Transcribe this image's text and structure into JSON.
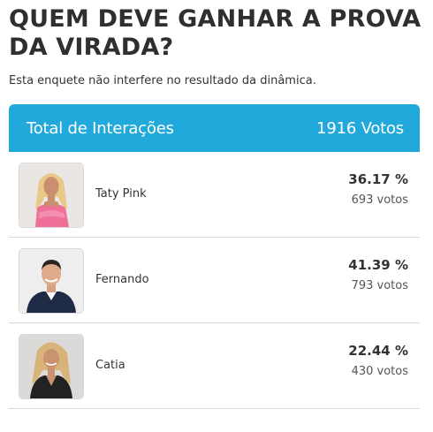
{
  "poll": {
    "title": "QUEM DEVE GANHAR A PROVA DA VIRADA?",
    "subtitle": "Esta enquete não interfere no resultado da dinâmica.",
    "total_label": "Total de Interações",
    "total_votes": "1916 Votos",
    "colors": {
      "header_bg": "#22a9dc",
      "header_text": "#ffffff"
    },
    "options": [
      {
        "name": "Taty Pink",
        "percent": "36.17 %",
        "votes": "693 votos",
        "avatar_icon": "photo-avatar"
      },
      {
        "name": "Fernando",
        "percent": "41.39 %",
        "votes": "793 votos",
        "avatar_icon": "photo-avatar"
      },
      {
        "name": "Catia",
        "percent": "22.44 %",
        "votes": "430 votos",
        "avatar_icon": "photo-avatar"
      }
    ]
  }
}
